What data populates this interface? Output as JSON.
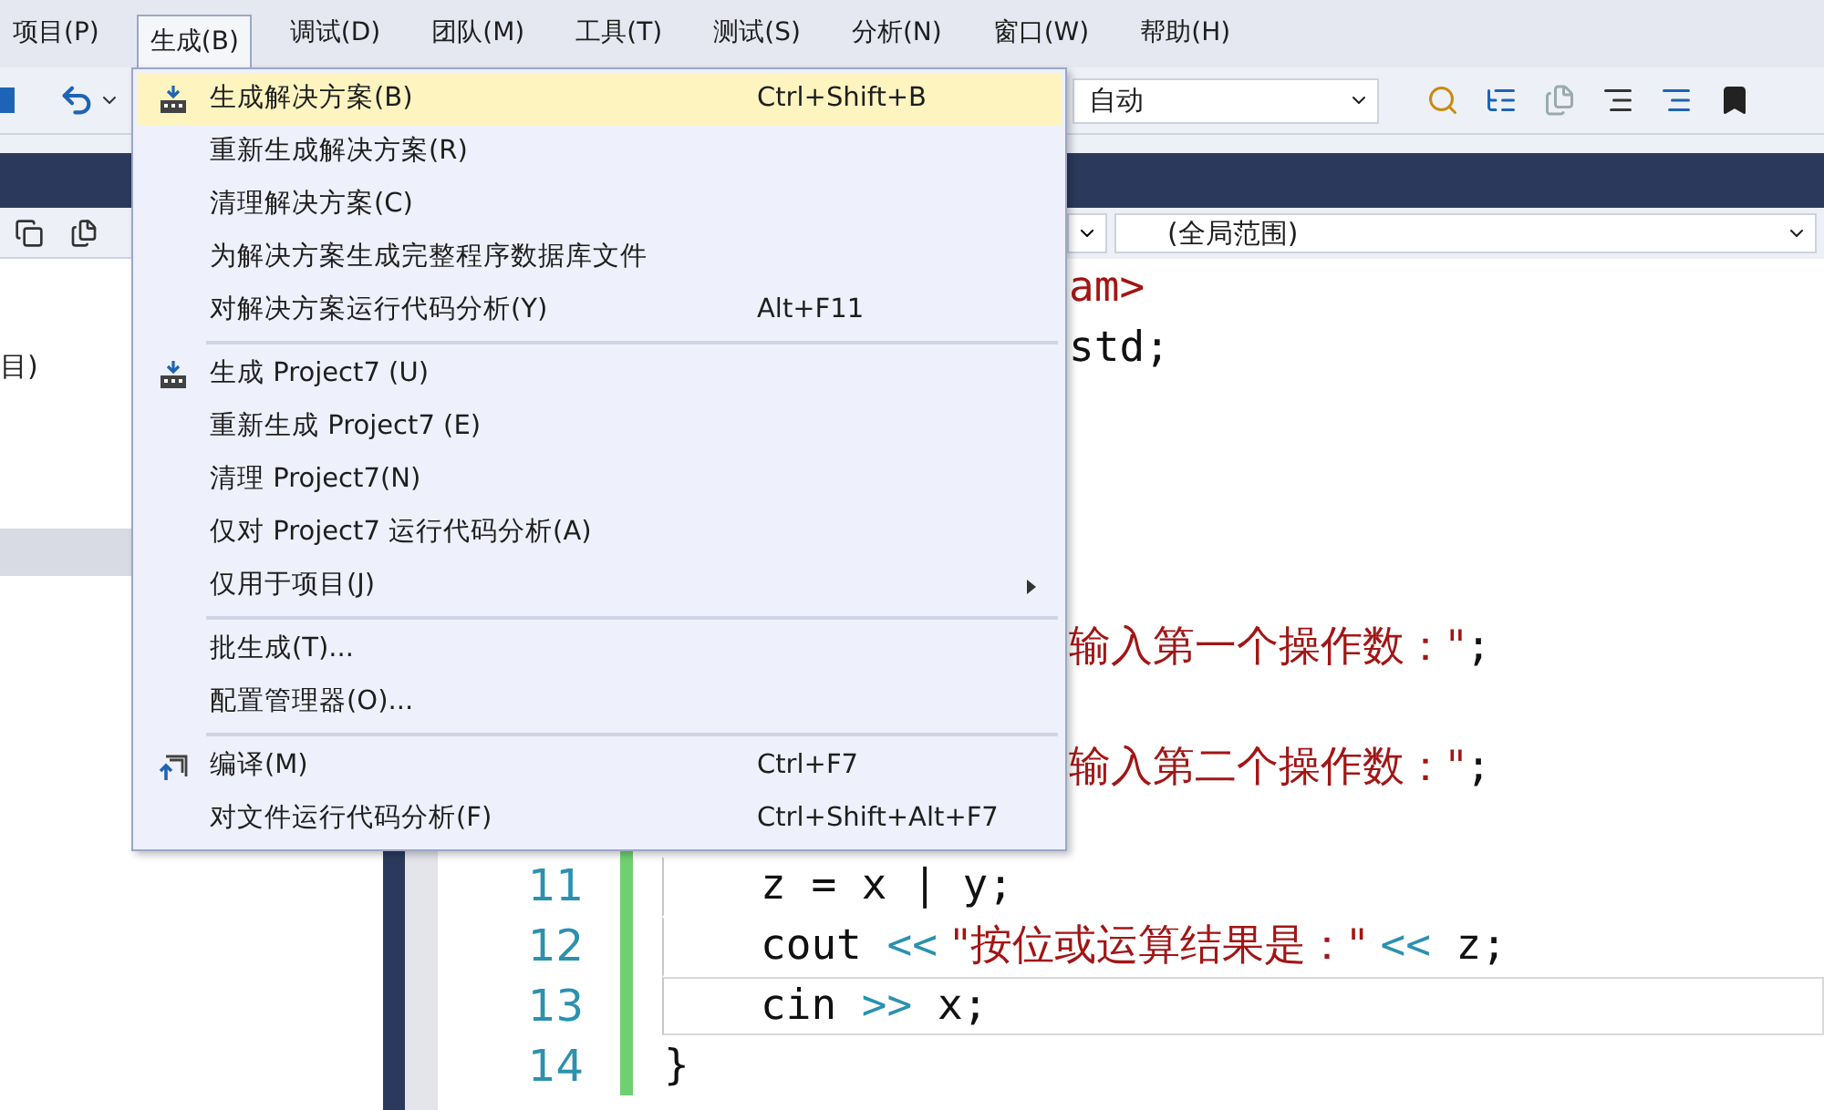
{
  "menu_bar": [
    {
      "label": "项目(P)",
      "selected": false
    },
    {
      "label": "生成(B)",
      "selected": true
    },
    {
      "label": "调试(D)",
      "selected": false
    },
    {
      "label": "团队(M)",
      "selected": false
    },
    {
      "label": "工具(T)",
      "selected": false
    },
    {
      "label": "测试(S)",
      "selected": false
    },
    {
      "label": "分析(N)",
      "selected": false
    },
    {
      "label": "窗口(W)",
      "selected": false
    },
    {
      "label": "帮助(H)",
      "selected": false
    }
  ],
  "toolbar": {
    "config_dropdown": "自动"
  },
  "navigation_bar": {
    "scope_dropdown": "(全局范围)"
  },
  "solution_explorer": {
    "items": [
      {
        "label": "目)",
        "selected": false
      },
      {
        "selected": true
      }
    ]
  },
  "editor": {
    "lines": [
      {
        "partly_hidden": true,
        "current": false,
        "tokens": [
          {
            "kind": "string",
            "text": "am>"
          }
        ]
      },
      {
        "partly_hidden": true,
        "current": false,
        "tokens": [
          {
            "kind": "plain",
            "text": "std;"
          }
        ]
      },
      {
        "partly_hidden": true,
        "current": false
      },
      {
        "partly_hidden": true,
        "current": false
      },
      {
        "partly_hidden": true,
        "current": false
      },
      {
        "partly_hidden": true,
        "current": false
      },
      {
        "partly_hidden": true,
        "current": false,
        "tokens": [
          {
            "kind": "string",
            "text": "输入第一个操作数：\""
          },
          {
            "kind": "plain",
            "text": ";"
          }
        ]
      },
      {
        "partly_hidden": true,
        "current": false
      },
      {
        "partly_hidden": true,
        "current": false,
        "tokens": [
          {
            "kind": "string",
            "text": "输入第二个操作数：\""
          },
          {
            "kind": "plain",
            "text": ";"
          }
        ]
      },
      {
        "partly_hidden": false,
        "changed": true,
        "current": false
      },
      {
        "number": "11",
        "partly_hidden": false,
        "indented": true,
        "changed": true,
        "current": false,
        "tokens": [
          {
            "kind": "plain",
            "text": "z = x | y;"
          }
        ]
      },
      {
        "number": "12",
        "partly_hidden": false,
        "indented": true,
        "changed": true,
        "current": false,
        "tokens": [
          {
            "kind": "plain",
            "text": "cout "
          },
          {
            "kind": "operator",
            "text": "<<"
          },
          {
            "kind": "string",
            "text": " \"按位或运算结果是：\" "
          },
          {
            "kind": "operator",
            "text": "<<"
          },
          {
            "kind": "plain",
            "text": " z;"
          }
        ]
      },
      {
        "number": "13",
        "partly_hidden": false,
        "indented": true,
        "changed": true,
        "current": true,
        "tokens": [
          {
            "kind": "plain",
            "text": "cin "
          },
          {
            "kind": "operator",
            "text": ">>"
          },
          {
            "kind": "plain",
            "text": " x;"
          }
        ]
      },
      {
        "number": "14",
        "partly_hidden": false,
        "indented": false,
        "changed": true,
        "current": false,
        "tokens": [
          {
            "kind": "plain",
            "text": "}"
          }
        ]
      }
    ]
  },
  "build_menu": [
    {
      "kind": "build",
      "label": "生成解决方案(B)",
      "shortcut": "Ctrl+Shift+B",
      "selected": true
    },
    {
      "kind": "item",
      "label": "重新生成解决方案(R)",
      "selected": false
    },
    {
      "kind": "item",
      "label": "清理解决方案(C)",
      "selected": false
    },
    {
      "kind": "item",
      "label": "为解决方案生成完整程序数据库文件",
      "selected": false
    },
    {
      "kind": "item",
      "label": "对解决方案运行代码分析(Y)",
      "shortcut": "Alt+F11",
      "selected": false
    },
    {
      "kind": "separator"
    },
    {
      "kind": "build",
      "label": "生成 Project7 (U)",
      "selected": false
    },
    {
      "kind": "item",
      "label": "重新生成 Project7 (E)",
      "selected": false
    },
    {
      "kind": "item",
      "label": "清理 Project7(N)",
      "selected": false
    },
    {
      "kind": "item",
      "label": "仅对 Project7 运行代码分析(A)",
      "selected": false
    },
    {
      "kind": "submenu",
      "label": "仅用于项目(J)",
      "selected": false
    },
    {
      "kind": "separator"
    },
    {
      "kind": "item",
      "label": "批生成(T)...",
      "selected": false
    },
    {
      "kind": "item",
      "label": "配置管理器(O)...",
      "selected": false
    },
    {
      "kind": "separator"
    },
    {
      "kind": "compile",
      "label": "编译(M)",
      "shortcut": "Ctrl+F7",
      "selected": false
    },
    {
      "kind": "item",
      "label": "对文件运行代码分析(F)",
      "shortcut": "Ctrl+Shift+Alt+F7",
      "selected": false
    }
  ]
}
